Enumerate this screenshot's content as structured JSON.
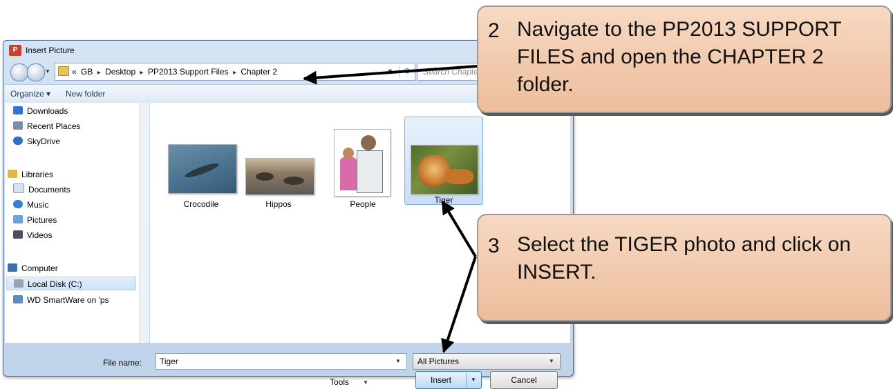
{
  "dialog": {
    "title": "Insert Picture",
    "app_icon_text": "P",
    "address": {
      "crumbs": [
        "«",
        "GB",
        "Desktop",
        "PP2013 Support Files",
        "Chapter 2"
      ]
    },
    "search_placeholder": "Search Chapter 2",
    "toolbar": {
      "organize_label": "Organize ▾",
      "new_folder_label": "New folder"
    },
    "nav_items": [
      {
        "label": "Downloads",
        "icon": "downloads-icon",
        "color": "#2f78d1"
      },
      {
        "label": "Recent Places",
        "icon": "recent-places-icon",
        "color": "#7a8ea8"
      },
      {
        "label": "SkyDrive",
        "icon": "skydrive-icon",
        "color": "#2f6fc4"
      },
      {
        "label": "Libraries",
        "icon": "libraries-icon",
        "color": "#e2b544"
      },
      {
        "label": "Documents",
        "icon": "documents-icon",
        "color": "#d9e3ef"
      },
      {
        "label": "Music",
        "icon": "music-icon",
        "color": "#3a7fd0"
      },
      {
        "label": "Pictures",
        "icon": "pictures-icon",
        "color": "#6aa3d8"
      },
      {
        "label": "Videos",
        "icon": "videos-icon",
        "color": "#4a4f5a"
      },
      {
        "label": "Computer",
        "icon": "computer-icon",
        "color": "#3a6fb0"
      },
      {
        "label": "Local Disk (C:)",
        "icon": "local-disk-icon",
        "color": "#9aa3ad"
      },
      {
        "label": "WD SmartWare on 'ps",
        "icon": "network-drive-icon",
        "color": "#5d8bbf"
      }
    ],
    "files": [
      {
        "label": "Crocodile",
        "selected": false
      },
      {
        "label": "Hippos",
        "selected": false
      },
      {
        "label": "People",
        "selected": false
      },
      {
        "label": "Tiger",
        "selected": true
      }
    ],
    "file_name_label": "File name:",
    "file_name_value": "Tiger",
    "file_type_value": "All Pictures",
    "tools_label": "Tools",
    "insert_label": "Insert",
    "cancel_label": "Cancel"
  },
  "callouts": [
    {
      "number": "2",
      "lines": [
        "Navigate to the PP2013 SUPPORT",
        "FILES and open the CHAPTER 2",
        "folder."
      ]
    },
    {
      "number": "3",
      "lines": [
        "Select the TIGER photo and click on",
        "INSERT."
      ]
    }
  ],
  "colors": {
    "callout_fill": "#f2c9ad",
    "selection": "#cfe2f7",
    "window_frame": "#c6d8ee"
  }
}
